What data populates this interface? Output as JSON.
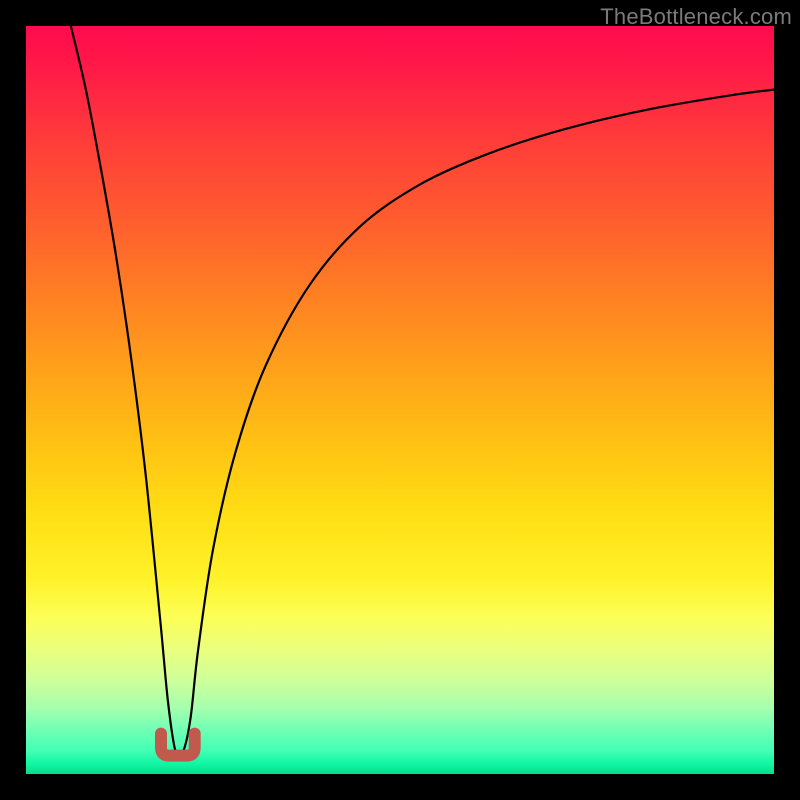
{
  "watermark": "TheBottleneck.com",
  "chart_data": {
    "type": "line",
    "title": "",
    "xlabel": "",
    "ylabel": "",
    "xlim": [
      0,
      1
    ],
    "ylim": [
      0,
      1
    ],
    "grid": false,
    "legend": false,
    "series": [
      {
        "name": "bottleneck-curve",
        "color": "#000000",
        "x": [
          0.06,
          0.08,
          0.1,
          0.12,
          0.14,
          0.16,
          0.18,
          0.19,
          0.2,
          0.21,
          0.22,
          0.23,
          0.25,
          0.28,
          0.32,
          0.38,
          0.45,
          0.53,
          0.62,
          0.72,
          0.83,
          0.94,
          1.0
        ],
        "y": [
          1.0,
          0.915,
          0.81,
          0.695,
          0.56,
          0.4,
          0.2,
          0.095,
          0.03,
          0.03,
          0.075,
          0.165,
          0.3,
          0.43,
          0.545,
          0.655,
          0.735,
          0.79,
          0.83,
          0.862,
          0.888,
          0.907,
          0.915
        ]
      }
    ],
    "marker": {
      "name": "sweet-spot",
      "shape": "u",
      "color": "#c05a4d",
      "x": 0.203,
      "y": 0.03,
      "width": 0.045
    },
    "background_gradient": {
      "stops": [
        {
          "pos": 0.0,
          "hex": "#ff0b4e"
        },
        {
          "pos": 0.25,
          "hex": "#ff5a2f"
        },
        {
          "pos": 0.5,
          "hex": "#ffb017"
        },
        {
          "pos": 0.75,
          "hex": "#fff838"
        },
        {
          "pos": 0.9,
          "hex": "#b4ffa2"
        },
        {
          "pos": 1.0,
          "hex": "#00e08c"
        }
      ]
    }
  }
}
